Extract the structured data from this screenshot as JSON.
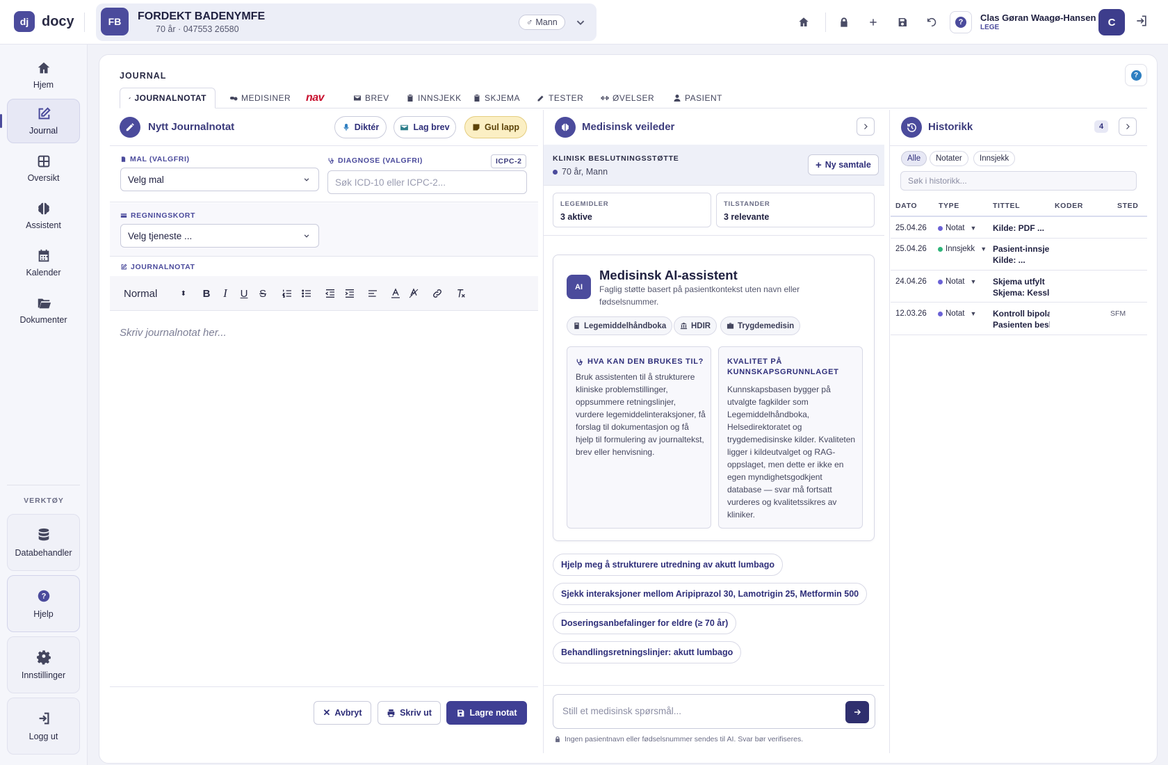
{
  "app": {
    "logo_mark": "dj",
    "logo_text": "docy"
  },
  "patient": {
    "initials": "FB",
    "name": "FORDEKT BADENYMFE",
    "sub": "70 år · 047553 26580",
    "gender": "Mann"
  },
  "user": {
    "name": "Clas Gøran Waagø-Hansen",
    "role": "LEGE",
    "avatar": "C"
  },
  "topbar": {
    "help_glyph": "?"
  },
  "sidebar": {
    "items": [
      {
        "label": "Hjem",
        "icon": "home-icon"
      },
      {
        "label": "Journal",
        "icon": "edit-icon"
      },
      {
        "label": "Oversikt",
        "icon": "grid-icon"
      },
      {
        "label": "Assistent",
        "icon": "brain-icon"
      },
      {
        "label": "Kalender",
        "icon": "calendar-icon"
      },
      {
        "label": "Dokumenter",
        "icon": "folder-icon"
      }
    ],
    "tools_title": "VERKTØY",
    "tools": [
      {
        "label": "Databehandler",
        "icon": "database-icon"
      },
      {
        "label": "Hjelp",
        "icon": "help-icon"
      },
      {
        "label": "Innstillinger",
        "icon": "gear-icon"
      },
      {
        "label": "Logg ut",
        "icon": "logout-icon"
      }
    ]
  },
  "journal": {
    "title": "JOURNAL",
    "tabs": [
      {
        "label": "JOURNALNOTAT"
      },
      {
        "label": "MEDISINER"
      },
      {
        "label": "nav"
      },
      {
        "label": "BREV"
      },
      {
        "label": "INNSJEKK"
      },
      {
        "label": "SKJEMA"
      },
      {
        "label": "TESTER"
      },
      {
        "label": "ØVELSER"
      },
      {
        "label": "PASIENT"
      }
    ]
  },
  "note": {
    "title": "Nytt Journalnotat",
    "buttons": {
      "dictate": "Diktér",
      "letter": "Lag brev",
      "sticky": "Gul lapp"
    },
    "template_label": "MAL (VALGFRI)",
    "template_value": "Velg mal",
    "diagnosis_label": "DIAGNOSE (VALGFRI)",
    "diagnosis_badge": "ICPC-2",
    "diagnosis_placeholder": "Søk ICD-10 eller ICPC-2...",
    "billing_label": "REGNINGSKORT",
    "billing_value": "Velg tjeneste ...",
    "note_label": "JOURNALNOTAT",
    "format_value": "Normal",
    "editor_placeholder": "Skriv journalnotat her...",
    "footer": {
      "cancel": "Avbryt",
      "print": "Skriv ut",
      "save": "Lagre notat"
    }
  },
  "advisor": {
    "title": "Medisinsk veileder",
    "support_title": "KLINISK BESLUTNINGSSTØTTE",
    "support_sub": "70 år, Mann",
    "new_chat": "Ny samtale",
    "stats": [
      {
        "label": "LEGEMIDLER",
        "value": "3 aktive"
      },
      {
        "label": "TILSTANDER",
        "value": "3 relevante"
      }
    ],
    "ai": {
      "badge": "AI",
      "title": "Medisinsk AI-assistent",
      "desc": "Faglig støtte basert på pasientkontekst uten navn eller fødselsnummer.",
      "sources": [
        "Legemiddelhåndboka",
        "HDIR",
        "Trygdemedisin"
      ],
      "use_title": "HVA KAN DEN BRUKES TIL?",
      "use_text": "Bruk assistenten til å strukturere kliniske problemstillinger, oppsummere retningslinjer, vurdere legemiddelinteraksjoner, få forslag til dokumentasjon og få hjelp til formulering av journaltekst, brev eller henvisning.",
      "quality_title": "KVALITET PÅ KUNNSKAPSGRUNNLAGET",
      "quality_text": "Kunnskapsbasen bygger på utvalgte fagkilder som Legemiddelhåndboka, Helsedirektoratet og trygdemedisinske kilder. Kvaliteten ligger i kildeutvalget og RAG-oppslaget, men dette er ikke en egen myndighetsgodkjent database — svar må fortsatt vurderes og kvalitetssikres av kliniker."
    },
    "suggestions": [
      "Hjelp meg å strukturere utredning av akutt lumbago",
      "Sjekk interaksjoner mellom Aripiprazol 30, Lamotrigin 25, Metformin 500",
      "Doseringsanbefalinger for eldre (≥ 70 år)",
      "Behandlingsretningslinjer: akutt lumbago"
    ],
    "input_placeholder": "Still et medisinsk spørsmål...",
    "privacy": "Ingen pasientnavn eller fødselsnummer sendes til AI. Svar bør verifiseres."
  },
  "history": {
    "title": "Historikk",
    "count": "4",
    "filters": [
      "Alle",
      "Notater",
      "Innsjekk"
    ],
    "search_placeholder": "Søk i historikk...",
    "columns": [
      "DATO",
      "TYPE",
      "TITTEL",
      "KODER",
      "STED"
    ],
    "rows": [
      {
        "date": "25.04.26",
        "type": "Notat",
        "type_color": "#6b62d6",
        "title1": "Kilde: PDF ...",
        "title2": "",
        "place": ""
      },
      {
        "date": "25.04.26",
        "type": "Innsjekk",
        "type_color": "#2fb57a",
        "title1": "Pasient-innsjekk",
        "title2": "Kilde: ...",
        "place": ""
      },
      {
        "date": "24.04.26",
        "type": "Notat",
        "type_color": "#6b62d6",
        "title1": "Skjema utfylt",
        "title2": "Skjema: Kessler",
        "place": ""
      },
      {
        "date": "12.03.26",
        "type": "Notat",
        "type_color": "#6b62d6",
        "title1": "Kontroll bipolar",
        "title2": "Pasienten beskriver",
        "place": "SFM"
      }
    ]
  },
  "colors": {
    "accent": "#4b4b9c",
    "primary_button": "#3f3f94",
    "sticky": "#fbefc4"
  }
}
